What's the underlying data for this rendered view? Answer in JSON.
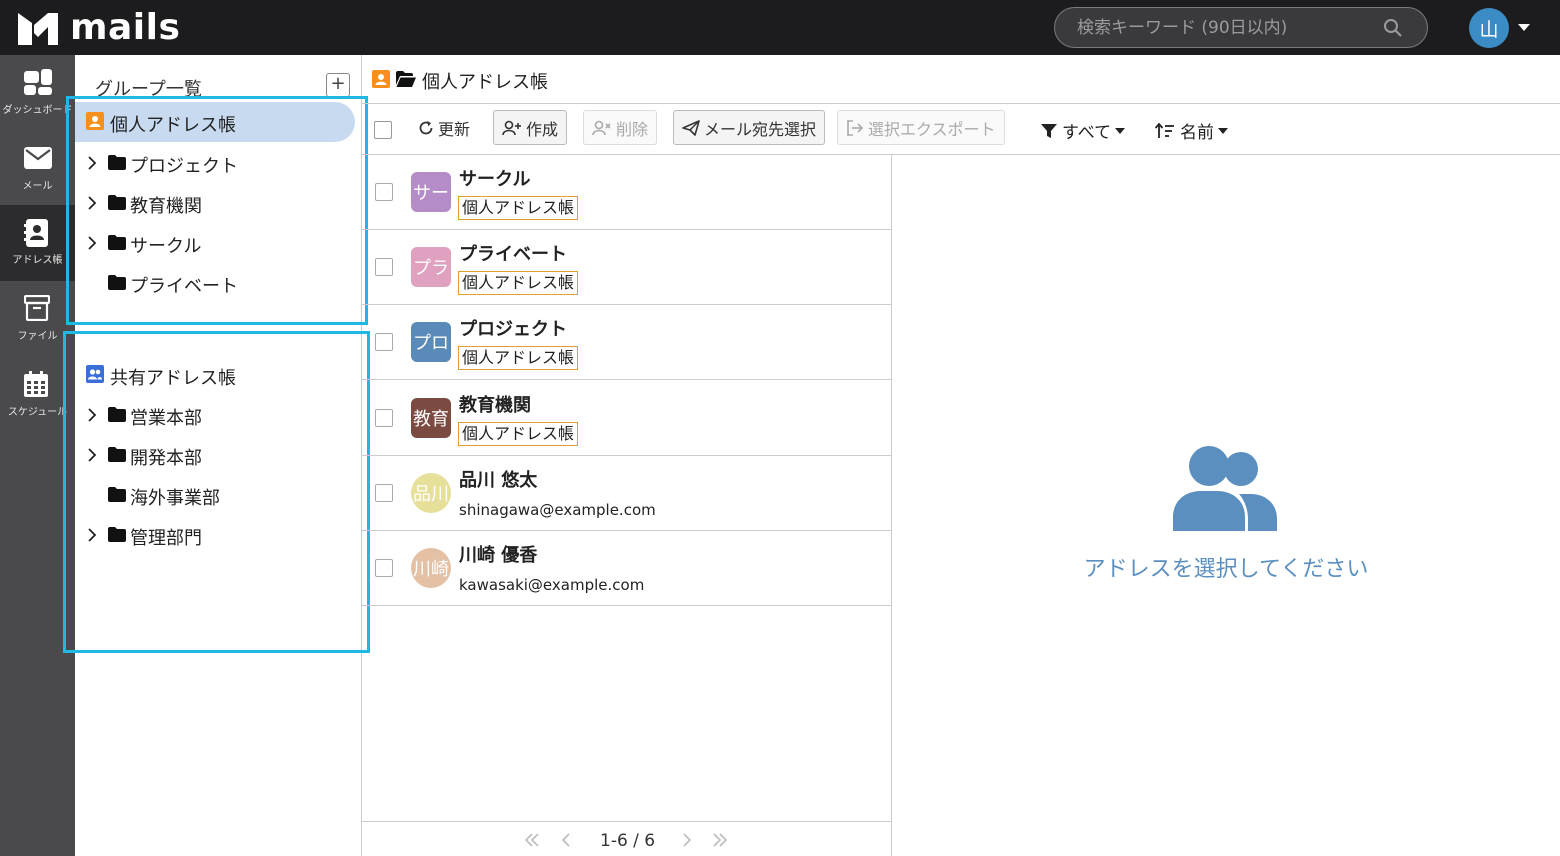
{
  "app": {
    "name": "mails"
  },
  "search": {
    "placeholder": "検索キーワード (90日以内)"
  },
  "user": {
    "initial": "山"
  },
  "rail": [
    {
      "label": "ダッシュボード",
      "icon": "dashboard-icon"
    },
    {
      "label": "メール",
      "icon": "mail-icon"
    },
    {
      "label": "アドレス帳",
      "icon": "addressbook-icon",
      "active": true
    },
    {
      "label": "ファイル",
      "icon": "archive-icon"
    },
    {
      "label": "スケジュール",
      "icon": "calendar-icon"
    }
  ],
  "groups": {
    "title": "グループ一覧",
    "add_label": "+",
    "personal": {
      "label": "個人アドレス帳",
      "children": [
        "プロジェクト",
        "教育機関",
        "サークル",
        "プライベート"
      ]
    },
    "shared": {
      "label": "共有アドレス帳",
      "children": [
        "営業本部",
        "開発本部",
        "海外事業部",
        "管理部門"
      ]
    }
  },
  "header": {
    "title": "個人アドレス帳"
  },
  "toolbar": {
    "refresh": "更新",
    "create": "作成",
    "delete": "削除",
    "select_recipient": "メール宛先選択",
    "export": "選択エクスポート",
    "filter": "すべて",
    "sort": "名前"
  },
  "list": [
    {
      "avatar": "サー",
      "name": "サークル",
      "tag": "個人アドレス帳",
      "color": "#b38cc8"
    },
    {
      "avatar": "プラ",
      "name": "プライベート",
      "tag": "個人アドレス帳",
      "color": "#e0a0c0"
    },
    {
      "avatar": "プロ",
      "name": "プロジェクト",
      "tag": "個人アドレス帳",
      "color": "#5a8ab8"
    },
    {
      "avatar": "教育",
      "name": "教育機関",
      "tag": "個人アドレス帳",
      "color": "#7b4a40"
    },
    {
      "avatar": "品川",
      "name": "品川 悠太",
      "email": "shinagawa@example.com",
      "color": "#e6e09a"
    },
    {
      "avatar": "川崎",
      "name": "川崎 優香",
      "email": "kawasaki@example.com",
      "color": "#e4c0a4"
    }
  ],
  "pager": {
    "info": "1-6 / 6"
  },
  "detail": {
    "empty_text": "アドレスを選択してください"
  },
  "colors": {
    "accent": "#1fb8e0",
    "selected": "#c7daf0",
    "tag_border": "#e0a030",
    "empty_icon": "#5b8fbf"
  }
}
